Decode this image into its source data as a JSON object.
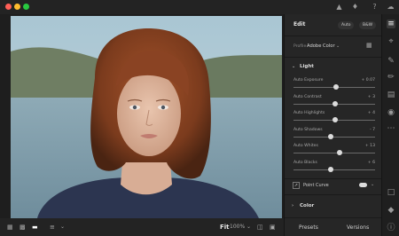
{
  "colors": {
    "close": "#ff5f57",
    "minimize": "#febc2e",
    "zoom": "#28c840"
  },
  "edit_panel": {
    "title": "Edit",
    "auto_label": "Auto",
    "bw_label": "B&W",
    "profile_label": "Profile",
    "profile_value": "Adobe Color",
    "light": {
      "title": "Light",
      "sliders": [
        {
          "label": "Auto Exposure",
          "value": "+ 0.07",
          "position": 0.52
        },
        {
          "label": "Auto Contrast",
          "value": "+ 3",
          "position": 0.51
        },
        {
          "label": "Auto Highlights",
          "value": "+ 4",
          "position": 0.51
        },
        {
          "label": "Auto Shadows",
          "value": "- 7",
          "position": 0.46
        },
        {
          "label": "Auto Whites",
          "value": "+ 13",
          "position": 0.56
        },
        {
          "label": "Auto Blacks",
          "value": "+ 6",
          "position": 0.46
        }
      ]
    },
    "point_curve_label": "Point Curve",
    "color_title": "Color"
  },
  "bottom_bar": {
    "fit_label": "Fit",
    "zoom_value": "100%",
    "presets_label": "Presets",
    "versions_label": "Versions"
  }
}
